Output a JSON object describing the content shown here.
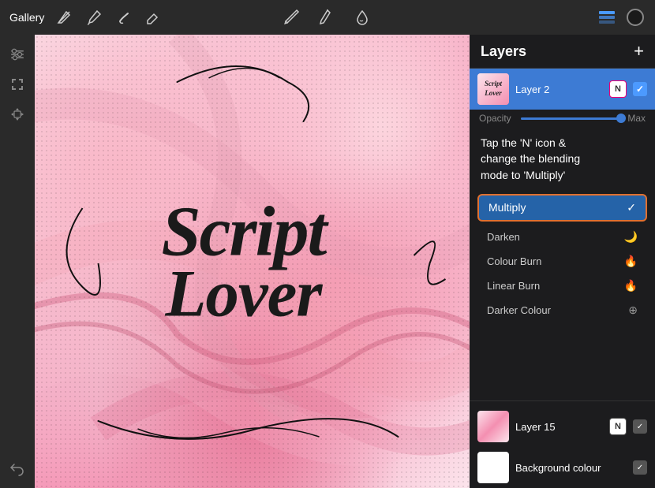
{
  "toolbar": {
    "gallery_label": "Gallery",
    "add_layer_label": "+",
    "tool_icons": [
      "✏️",
      "✒️",
      "✍️",
      "⊕"
    ]
  },
  "layers_panel": {
    "title": "Layers",
    "layer2": {
      "name": "Layer 2",
      "blend_mode_btn": "N",
      "opacity_label": "Opacity",
      "opacity_max": "Max"
    },
    "instruction": "Tap the 'N' icon &\nchange the blending\nmode to 'Multiply'",
    "blend_modes": [
      {
        "name": "Multiply",
        "selected": true
      },
      {
        "name": "Darken",
        "selected": false
      },
      {
        "name": "Colour Burn",
        "selected": false
      },
      {
        "name": "Linear Burn",
        "selected": false
      },
      {
        "name": "Darker Colour",
        "selected": false
      }
    ],
    "layer15": {
      "name": "Layer 15",
      "blend_mode_btn": "N"
    },
    "background_colour": {
      "name": "Background colour"
    }
  },
  "canvas": {
    "line1": "Script",
    "line2": "Lover"
  }
}
